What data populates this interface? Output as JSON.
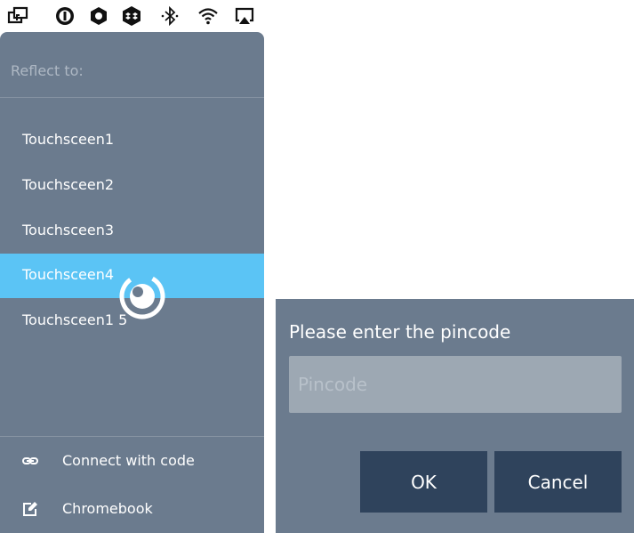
{
  "menubar": {
    "icons": [
      "display-mirror-icon",
      "onepassword-icon",
      "settings-hex-icon",
      "dropbox-icon",
      "bluetooth-icon",
      "wifi-icon",
      "airplay-icon"
    ]
  },
  "panel": {
    "header": "Reflect to:",
    "items": [
      {
        "label": "Touchsceen1",
        "selected": false
      },
      {
        "label": "Touchsceen2",
        "selected": false
      },
      {
        "label": "Touchsceen3",
        "selected": false
      },
      {
        "label": "Touchsceen4",
        "selected": true
      },
      {
        "label": "Touchsceen1 5",
        "selected": false
      }
    ],
    "actions": [
      {
        "label": "Connect with code",
        "icon": "link-icon"
      },
      {
        "label": "Chromebook",
        "icon": "edit-icon"
      }
    ]
  },
  "dialog": {
    "title": "Please enter the pincode",
    "input": {
      "placeholder": "Pincode",
      "value": ""
    },
    "ok_label": "OK",
    "cancel_label": "Cancel"
  },
  "colors": {
    "panel_bg": "#6b7b8e",
    "selected_bg": "#5bc4f5",
    "button_bg": "#2f435c",
    "input_bg": "#9da8b3"
  }
}
